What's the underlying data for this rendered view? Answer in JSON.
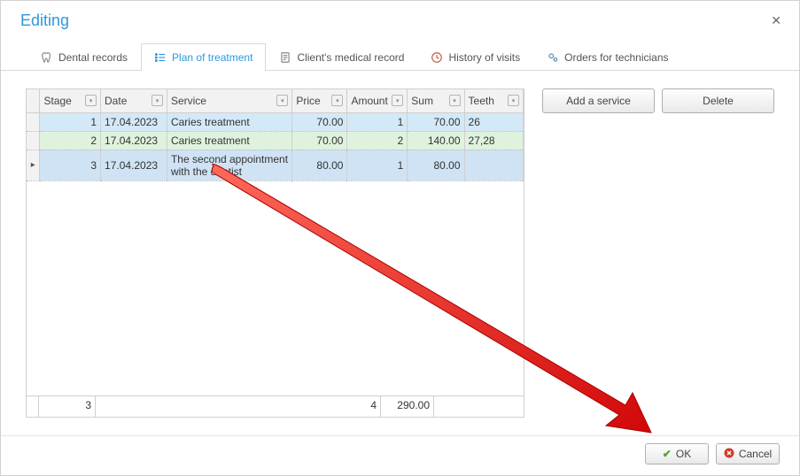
{
  "dialog": {
    "title": "Editing"
  },
  "tabs": [
    {
      "label": "Dental records",
      "icon_name": "tooth-icon"
    },
    {
      "label": "Plan of treatment",
      "icon_name": "list-icon"
    },
    {
      "label": "Client's medical record",
      "icon_name": "doc-icon"
    },
    {
      "label": "History of visits",
      "icon_name": "history-icon"
    },
    {
      "label": "Orders for technicians",
      "icon_name": "gears-icon"
    }
  ],
  "active_tab": 1,
  "buttons": {
    "add_service": "Add a service",
    "delete": "Delete",
    "ok": "OK",
    "cancel": "Cancel"
  },
  "columns": [
    {
      "label": "Stage"
    },
    {
      "label": "Date"
    },
    {
      "label": "Service"
    },
    {
      "label": "Price"
    },
    {
      "label": "Amount"
    },
    {
      "label": "Sum"
    },
    {
      "label": "Teeth"
    }
  ],
  "rows": [
    {
      "style": "blue",
      "stage": "1",
      "date": "17.04.2023",
      "service": "Caries treatment",
      "price": "70.00",
      "amount": "1",
      "sum": "70.00",
      "teeth": "26"
    },
    {
      "style": "green",
      "stage": "2",
      "date": "17.04.2023",
      "service": "Caries treatment",
      "price": "70.00",
      "amount": "2",
      "sum": "140.00",
      "teeth": "27,28"
    },
    {
      "style": "sel",
      "indicator": "▸",
      "stage": "3",
      "date": "17.04.2023",
      "service": "The second appointment with the dentist",
      "price": "80.00",
      "amount": "1",
      "sum": "80.00",
      "teeth": ""
    }
  ],
  "footer_totals": {
    "stage": "3",
    "amount": "4",
    "sum": "290.00"
  }
}
